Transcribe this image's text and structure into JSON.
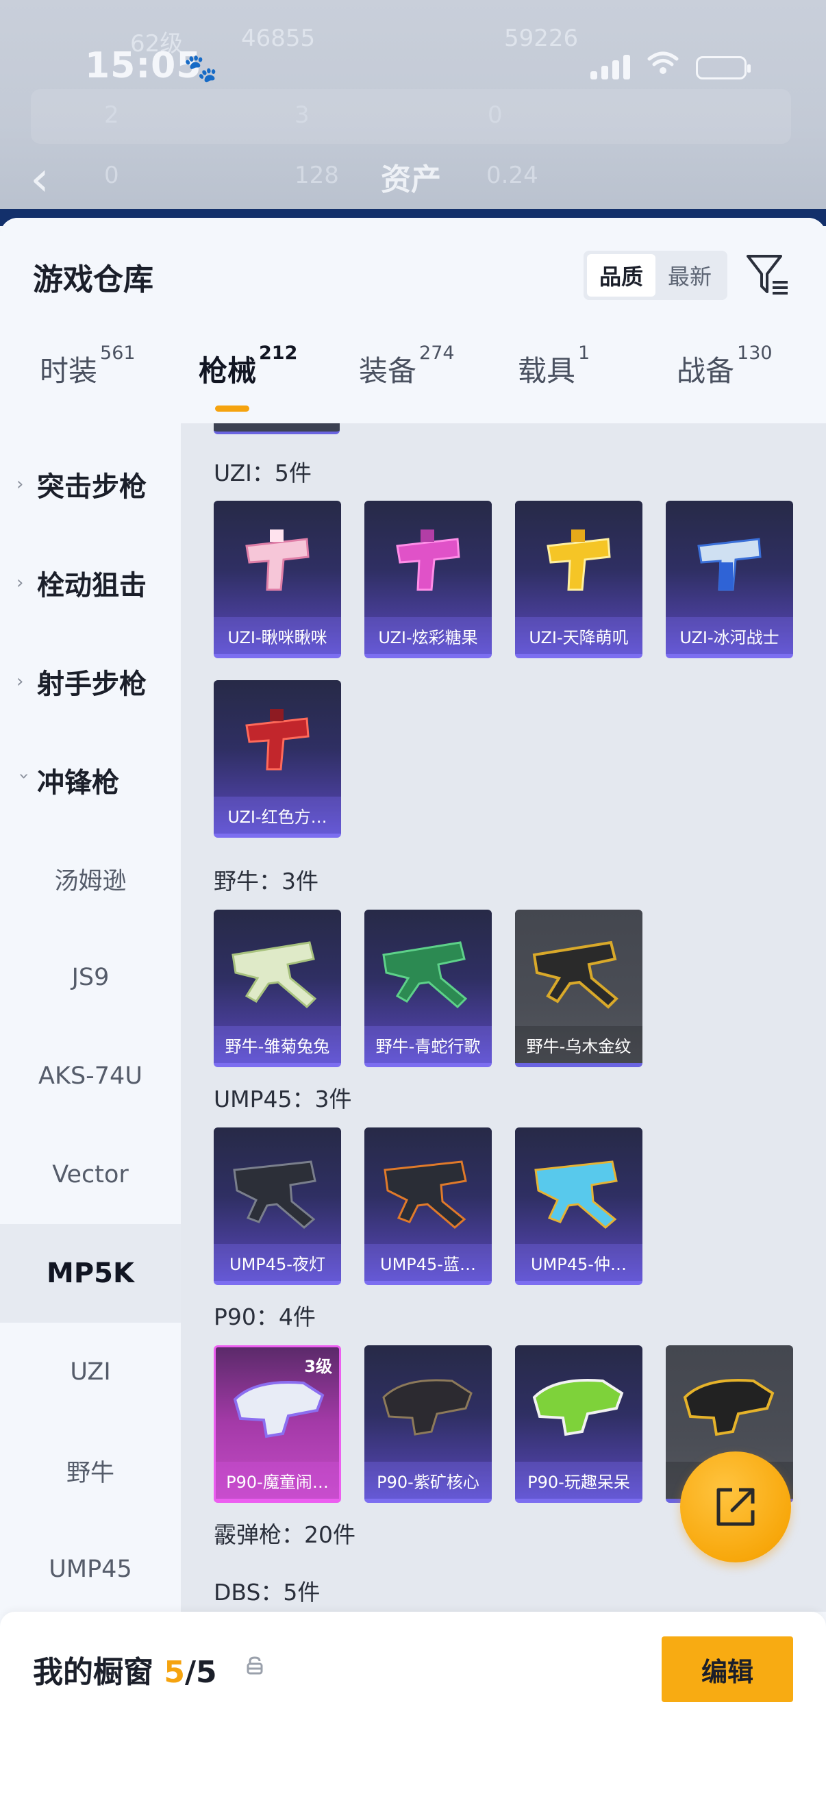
{
  "status_bar": {
    "time": "15:05"
  },
  "background_page": {
    "title": "资产",
    "ghost_values": [
      "62级",
      "46855",
      "59226",
      "2",
      "3",
      "0",
      "0",
      "128",
      "0.24"
    ]
  },
  "sheet": {
    "title": "游戏仓库",
    "sort_options": [
      "品质",
      "最新"
    ],
    "active_sort": "品质",
    "tabs": [
      {
        "label": "时装",
        "count": "561"
      },
      {
        "label": "枪械",
        "count": "212"
      },
      {
        "label": "装备",
        "count": "274"
      },
      {
        "label": "载具",
        "count": "1"
      },
      {
        "label": "战备",
        "count": "130"
      }
    ],
    "active_tab": "枪械"
  },
  "rail": {
    "categories": [
      {
        "label": "突击步枪",
        "expanded": false
      },
      {
        "label": "栓动狙击",
        "expanded": false
      },
      {
        "label": "射手步枪",
        "expanded": false
      },
      {
        "label": "冲锋枪",
        "expanded": true
      }
    ],
    "sub_items": [
      "汤姆逊",
      "JS9",
      "AKS-74U",
      "Vector",
      "MP5K",
      "UZI",
      "野牛",
      "UMP45"
    ],
    "active_sub": "MP5K"
  },
  "groups": [
    {
      "label": "UZI：5件",
      "items": [
        "UZI-瞅咪瞅咪",
        "UZI-炫彩糖果",
        "UZI-天降萌叽",
        "UZI-冰河战士",
        "UZI-红色方…"
      ]
    },
    {
      "label": "野牛：3件",
      "items": [
        "野牛-雏菊兔兔",
        "野牛-青蛇行歌",
        "野牛-乌木金纹"
      ]
    },
    {
      "label": "UMP45：3件",
      "items": [
        "UMP45-夜灯",
        "UMP45-蓝…",
        "UMP45-仲…"
      ]
    },
    {
      "label": "P90：4件",
      "items": [
        "P90-魔童闹…",
        "P90-紫矿核心",
        "P90-玩趣呆呆",
        "P9…纹"
      ]
    },
    {
      "label": "霰弹枪：20件",
      "items": []
    },
    {
      "label": "DBS：5件",
      "items": []
    }
  ],
  "p90_badge": "3级",
  "bottom_bar": {
    "label": "我的橱窗",
    "current": "5",
    "separator": "/",
    "total": "5",
    "edit_label": "编辑"
  },
  "colors": {
    "accent": "#f5a30f",
    "card_purple": "#5b50c9",
    "card_pink": "#c44cc6",
    "card_gray": "#4a4d55"
  }
}
